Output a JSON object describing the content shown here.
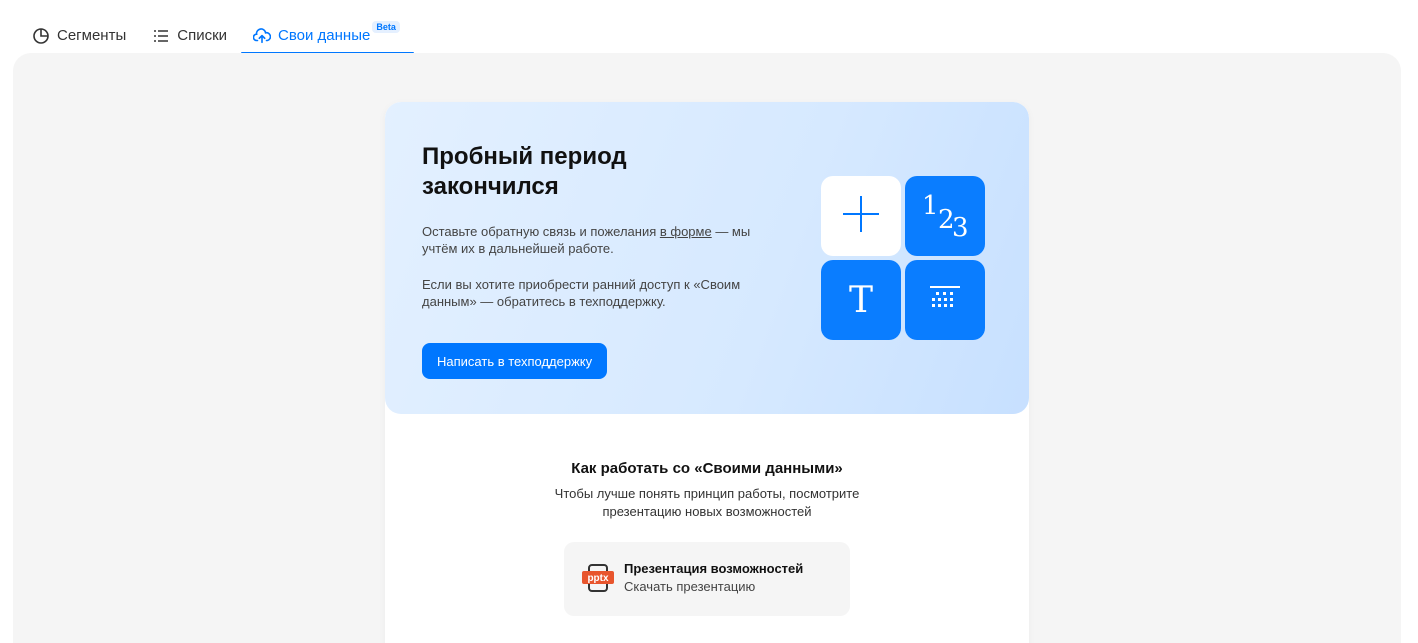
{
  "tabs": [
    {
      "label": "Сегменты",
      "icon": "pie-chart-icon"
    },
    {
      "label": "Списки",
      "icon": "list-icon"
    },
    {
      "label": "Свои данные",
      "icon": "cloud-upload-icon",
      "badge": "Beta",
      "active": true
    }
  ],
  "hero": {
    "title": "Пробный период закончился",
    "p1_before": "Оставьте обратную связь и пожелания ",
    "p1_link": "в форме",
    "p1_after": " — мы учтём их в дальнейшей работе.",
    "p2": "Если вы хотите приобрести ранний доступ к «Своим данным» — обратитесь в техподдержку.",
    "button": "Написать в техподдержку",
    "tiles": {
      "plus": "plus-icon",
      "numbers": "123",
      "text": "T",
      "table": "table-icon"
    }
  },
  "how": {
    "title": "Как работать со «Своими данными»",
    "description": "Чтобы лучше понять принцип работы, посмотрите презентацию новых возможностей",
    "presentation": {
      "icon_label": "pptx",
      "title": "Презентация возможностей",
      "subtitle": "Скачать презентацию"
    }
  },
  "colors": {
    "accent": "#0077ff",
    "panel": "#f5f5f5"
  }
}
